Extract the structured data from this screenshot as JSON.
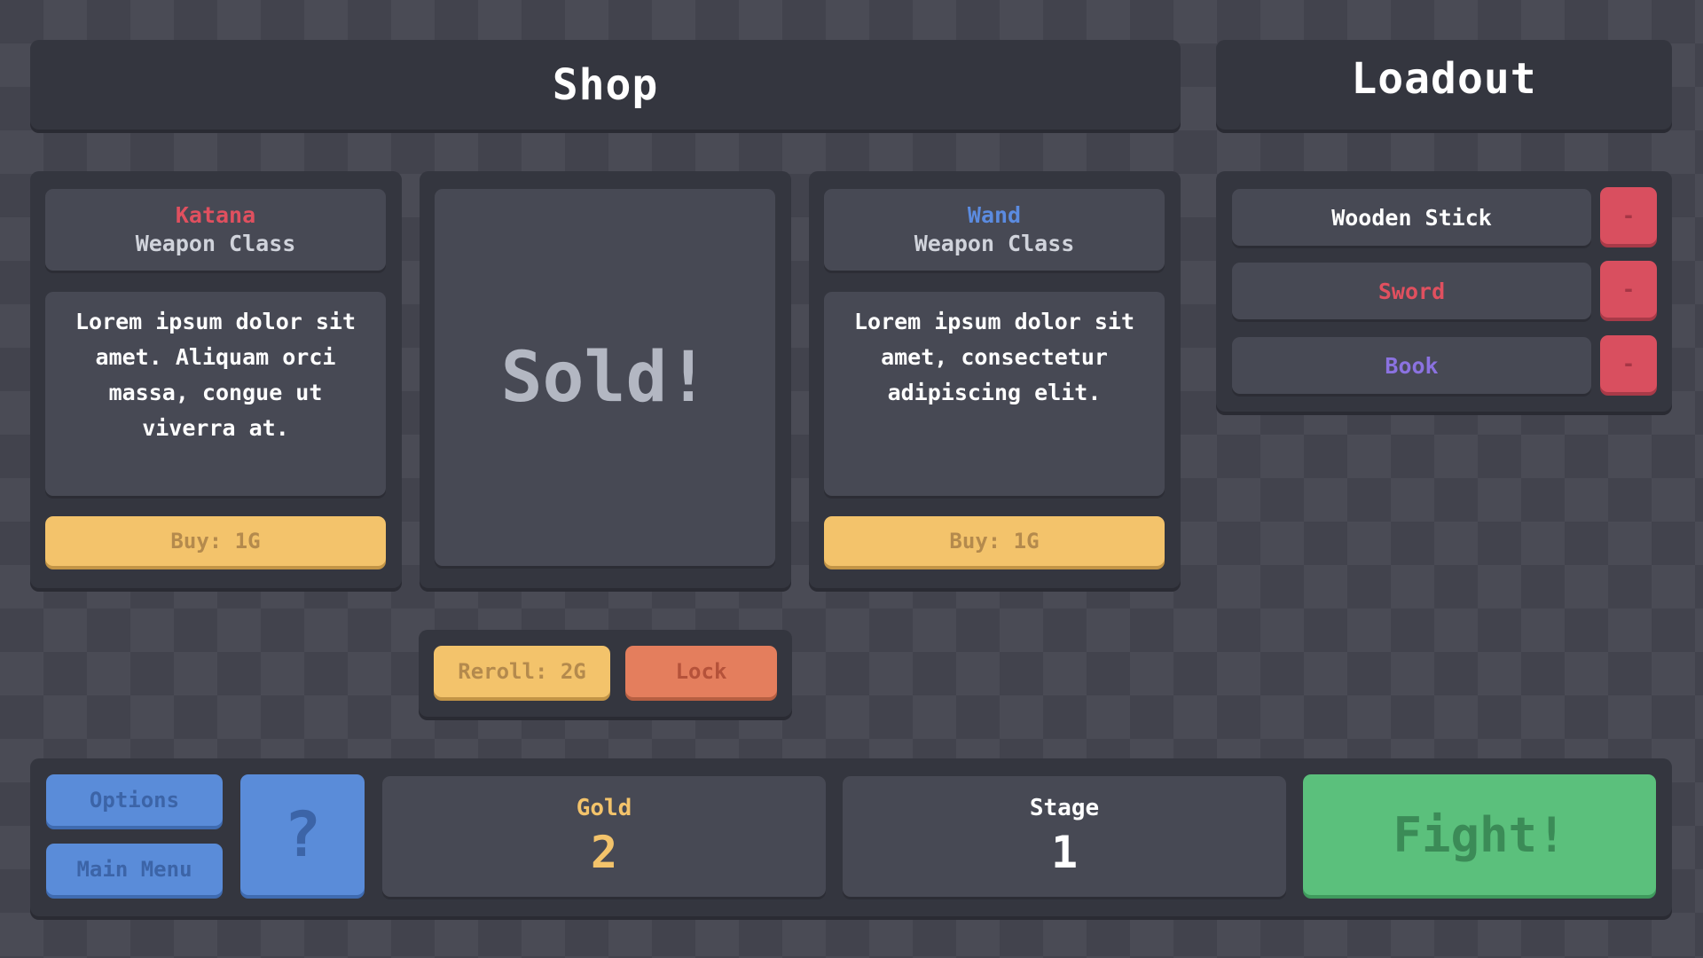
{
  "shop": {
    "title": "Shop",
    "cards": [
      {
        "name": "Katana",
        "name_color": "#e0505f",
        "class": "Weapon Class",
        "description": "Lorem ipsum dolor sit amet. Aliquam orci massa, congue ut viverra at.",
        "buy_label": "Buy: 1G"
      },
      {
        "sold_label": "Sold!"
      },
      {
        "name": "Wand",
        "name_color": "#5b8be0",
        "class": "Weapon Class",
        "description": "Lorem ipsum dolor sit amet, consectetur adipiscing elit.",
        "buy_label": "Buy: 1G"
      }
    ],
    "reroll_label": "Reroll: 2G",
    "lock_label": "Lock"
  },
  "loadout": {
    "title": "Loadout",
    "items": [
      {
        "name": "Wooden Stick",
        "color": "#ffffff",
        "remove_label": "-"
      },
      {
        "name": "Sword",
        "color": "#e0505f",
        "remove_label": "-"
      },
      {
        "name": "Book",
        "color": "#8b72e0",
        "remove_label": "-"
      }
    ]
  },
  "bottom": {
    "options_label": "Options",
    "main_menu_label": "Main Menu",
    "help_label": "?",
    "gold": {
      "label": "Gold",
      "value": "2",
      "color": "#f3c36b"
    },
    "stage": {
      "label": "Stage",
      "value": "1",
      "color": "#ffffff"
    },
    "fight_label": "Fight!"
  },
  "colors": {
    "background": "#42434d",
    "panel": "#34363f",
    "inner": "#474954",
    "yellow": "#f3c36b",
    "orange": "#e47e5d",
    "blue": "#5a8cd9",
    "green": "#5bc07c",
    "red": "#d94f5f"
  }
}
